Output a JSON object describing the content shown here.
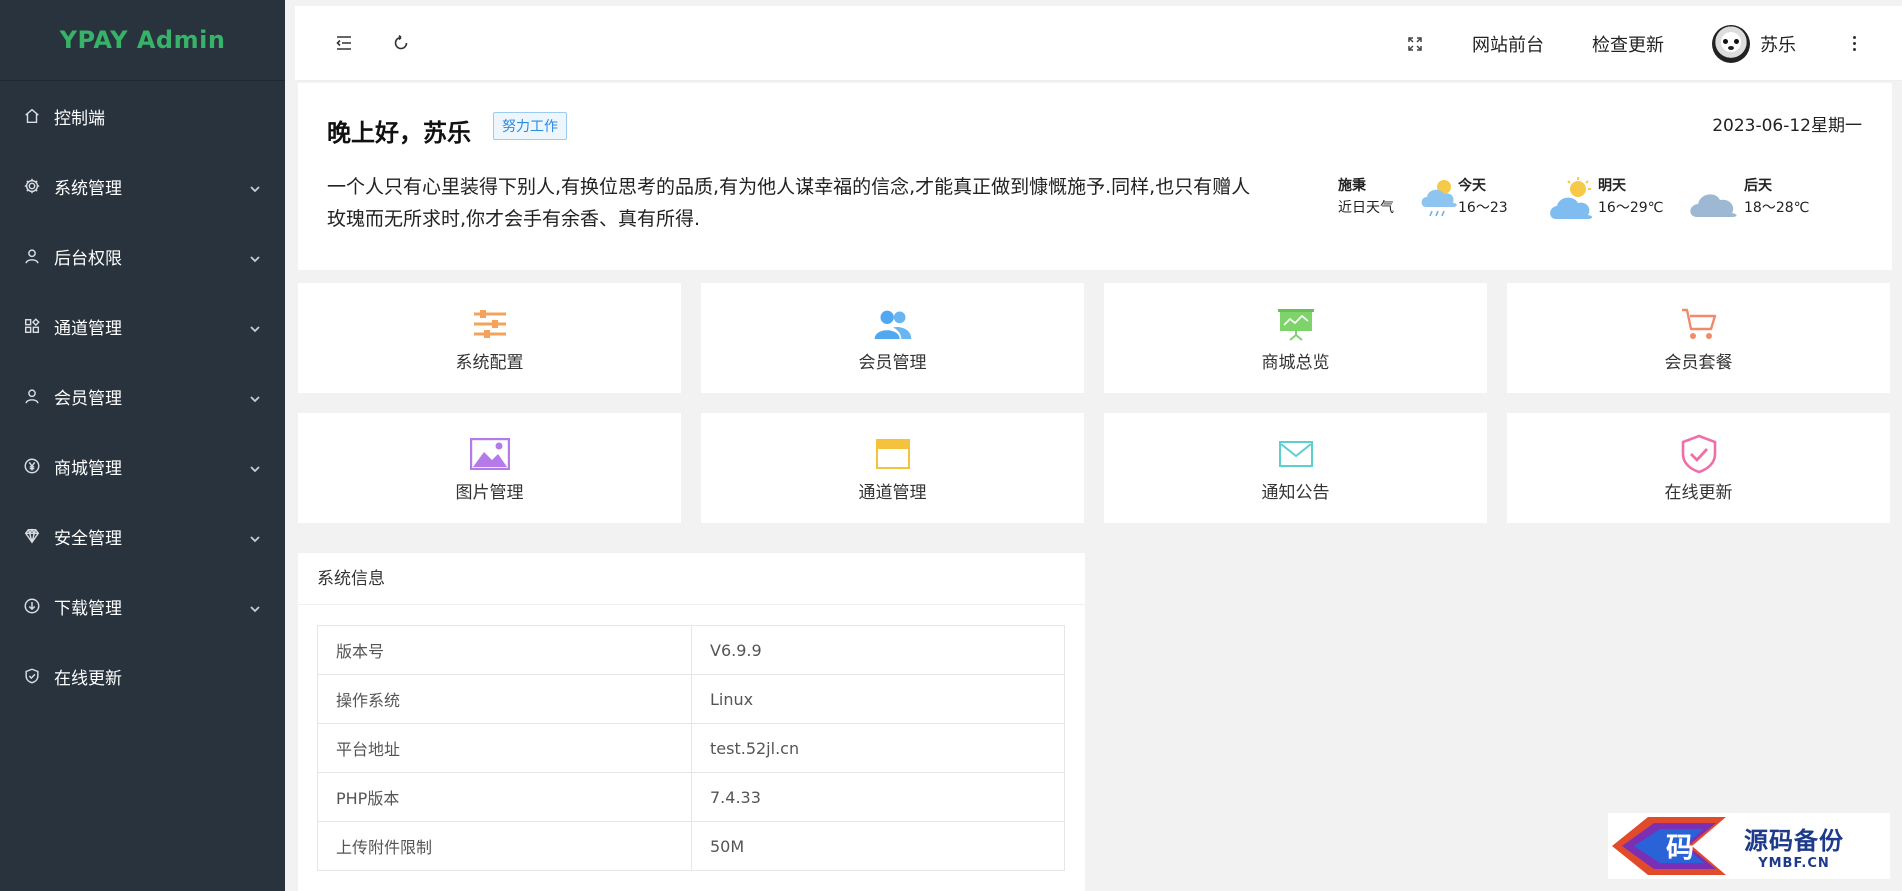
{
  "brand": {
    "title": "YPAY Admin",
    "color": "#36b368"
  },
  "sidebar": {
    "items": [
      {
        "label": "控制端",
        "icon": "home-icon",
        "expandable": false
      },
      {
        "label": "系统管理",
        "icon": "gear-icon",
        "expandable": true
      },
      {
        "label": "后台权限",
        "icon": "user-icon",
        "expandable": true
      },
      {
        "label": "通道管理",
        "icon": "apps-icon",
        "expandable": true
      },
      {
        "label": "会员管理",
        "icon": "user-icon",
        "expandable": true
      },
      {
        "label": "商城管理",
        "icon": "yen-icon",
        "expandable": true
      },
      {
        "label": "安全管理",
        "icon": "diamond-icon",
        "expandable": true
      },
      {
        "label": "下载管理",
        "icon": "download-icon",
        "expandable": true
      },
      {
        "label": "在线更新",
        "icon": "shield-check-icon",
        "expandable": false
      }
    ]
  },
  "header": {
    "site_front": "网站前台",
    "check_update": "检查更新",
    "user_name": "苏乐"
  },
  "welcome": {
    "greeting": "晚上好，苏乐",
    "tag": "努力工作",
    "date": "2023-06-12星期一",
    "quote": "一个人只有心里装得下别人,有换位思考的品质,有为他人谋幸福的信念,才能真正做到慷慨施予.同样,也只有赠人玫瑰而无所求时,你才会手有余香、真有所得."
  },
  "weather": {
    "location": "施秉",
    "caption": "近日天气",
    "days": [
      {
        "label": "今天",
        "range": "16～23",
        "icon": "rain-cloud-icon"
      },
      {
        "label": "明天",
        "range": "16～29℃",
        "icon": "sun-cloud-icon"
      },
      {
        "label": "后天",
        "range": "18～28℃",
        "icon": "cloud-icon"
      }
    ]
  },
  "tiles": [
    {
      "label": "系统配置",
      "icon": "sliders-icon",
      "color": "#f5a35b"
    },
    {
      "label": "会员管理",
      "icon": "users-icon",
      "color": "#4fa8f0"
    },
    {
      "label": "商城总览",
      "icon": "presentation-icon",
      "color": "#7ed36a"
    },
    {
      "label": "会员套餐",
      "icon": "cart-icon",
      "color": "#f08a6a"
    },
    {
      "label": "图片管理",
      "icon": "image-icon",
      "color": "#b47ae8"
    },
    {
      "label": "通道管理",
      "icon": "window-icon",
      "color": "#f5c33b"
    },
    {
      "label": "通知公告",
      "icon": "mail-icon",
      "color": "#5ccfd0"
    },
    {
      "label": "在线更新",
      "icon": "shield-check-icon",
      "color": "#ef6fa8"
    }
  ],
  "sysinfo": {
    "title": "系统信息",
    "rows": [
      {
        "key": "版本号",
        "value": "V6.9.9"
      },
      {
        "key": "操作系统",
        "value": "Linux"
      },
      {
        "key": "平台地址",
        "value": "test.52jl.cn"
      },
      {
        "key": "PHP版本",
        "value": "7.4.33"
      },
      {
        "key": "上传附件限制",
        "value": "50M"
      }
    ]
  },
  "watermark": {
    "logo_char": "码",
    "cn": "源码备份",
    "en": "YMBF.CN"
  }
}
